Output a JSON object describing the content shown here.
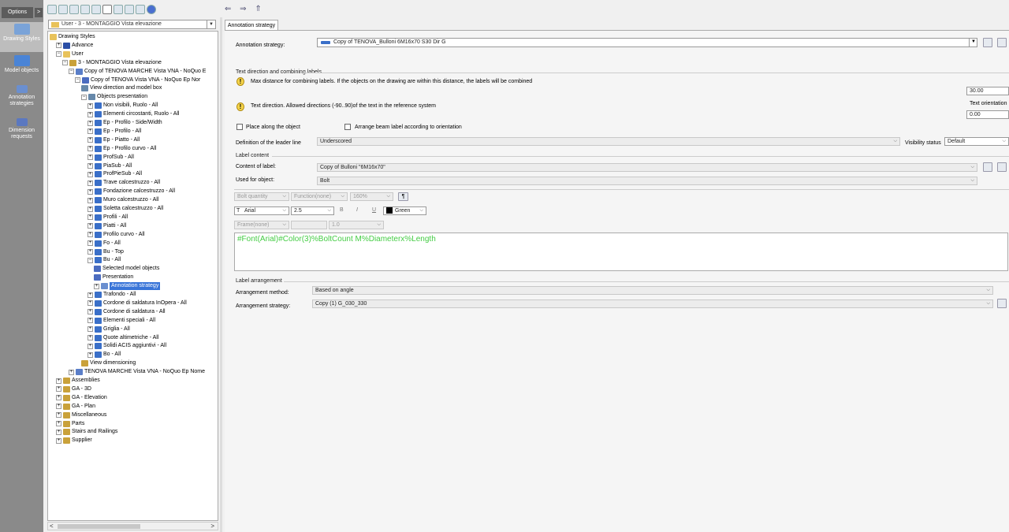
{
  "sidebar": {
    "options_label": "Options",
    "options_arrow": ">",
    "items": [
      {
        "label": "Drawing Styles"
      },
      {
        "label": "Model objects"
      },
      {
        "label": "Annotation strategies"
      },
      {
        "label": "Dimension requests"
      }
    ]
  },
  "nav_arrows": "⇐ ⇒ ⇑",
  "tree": {
    "selector": "User - 3 - MONTAGGIO Vista elevazione",
    "rows": [
      "Drawing Styles",
      "Advance",
      "User",
      "3 - MONTAGGIO Vista elevazione",
      "Copy of TENOVA MARCHE Vista VNA - NoQuo E",
      "Copy of TENOVA Vista VNA - NoQuo Ep Nor",
      "View direction and model box",
      "Objects presentation",
      "Non visibili, Ruolo - All",
      "Elementi circostanti, Ruolo - All",
      "Ep - Profilo - Side/Width",
      "Ep - Profilo - All",
      "Ep - Piatto - All",
      "Ep - Profilo curvo - All",
      "ProfSub - All",
      "PiaSub - All",
      "ProfPieSub - All",
      "Trave calcestruzzo - All",
      "Fondazione calcestruzzo - All",
      "Muro calcestruzzo - All",
      "Soletta calcestruzzo - All",
      "Profili - All",
      "Piatti - All",
      "Profilo curvo - All",
      "Fo - All",
      "Bu - Top",
      "Bu - All",
      "Selected model objects",
      "Presentation",
      "Annotation strategy",
      "Trafondo - All",
      "Cordone di saldatura InOpera - All",
      "Cordone di saldatura - All",
      "Elementi speciali - All",
      "Griglia - All",
      "Quote altimetriche - All",
      "Solidi ACIS aggiuntivi - All",
      "Bo - All",
      "View dimensioning",
      "TENOVA MARCHE Vista VNA - NoQuo Ep Nome",
      "Assemblies",
      "GA - 3D",
      "GA - Elevation",
      "GA - Plan",
      "Miscellaneous",
      "Parts",
      "Stairs and Railings",
      "Supplier"
    ],
    "scroll_left": "<",
    "scroll_right": ">"
  },
  "tab": {
    "label": "Annotation strategy"
  },
  "form": {
    "annotation_strategy_label": "Annotation strategy:",
    "annotation_strategy_value": "Copy of TENOVA_Bulloni 6M16x70 S30 Dir G",
    "text_dir_section": "Text direction and combining labels",
    "max_distance_text": "Max distance for combining labels. If the objects on the drawing are within this distance, the labels will be combined",
    "max_distance_value": "30.00",
    "text_direction_text": "Text direction. Allowed directions (-90..90)of the text in the reference system",
    "text_orientation_label": "Text orientation",
    "text_orientation_value": "0.00",
    "place_along_label": "Place along the object",
    "arrange_beam_label": "Arrange beam label according to orientation",
    "leader_line_label": "Definition of the leader line",
    "leader_line_value": "Underscored",
    "visibility_label": "Visibility status",
    "visibility_value": "Default",
    "label_content_section": "Label content",
    "content_label": "Content of label:",
    "content_value": "Copy of Bulloni \"6M16x70\"",
    "used_for_label": "Used for object:",
    "used_for_value": "Bolt",
    "bolt_quantity": "Bolt quantity",
    "function_value": "Function(none)",
    "scale_value": "160%",
    "font_value": "Arial",
    "size_value": "2.5",
    "bold": "B",
    "italic": "I",
    "underline": "U",
    "color_value": "Green",
    "frame_value": "Frame(none)",
    "ratio_value": "1.0",
    "template_text": "#Font(Arial)#Color(3)%BoltCount M%Diameterx%Length",
    "label_arrangement_section": "Label arrangement",
    "arrangement_method_label": "Arrangement method:",
    "arrangement_method_value": "Based on angle",
    "arrangement_strategy_label": "Arrangement strategy:",
    "arrangement_strategy_value": "Copy (1) G_030_330"
  },
  "colors": {
    "template_text": "#44cc44",
    "selection": "#3874d8"
  }
}
